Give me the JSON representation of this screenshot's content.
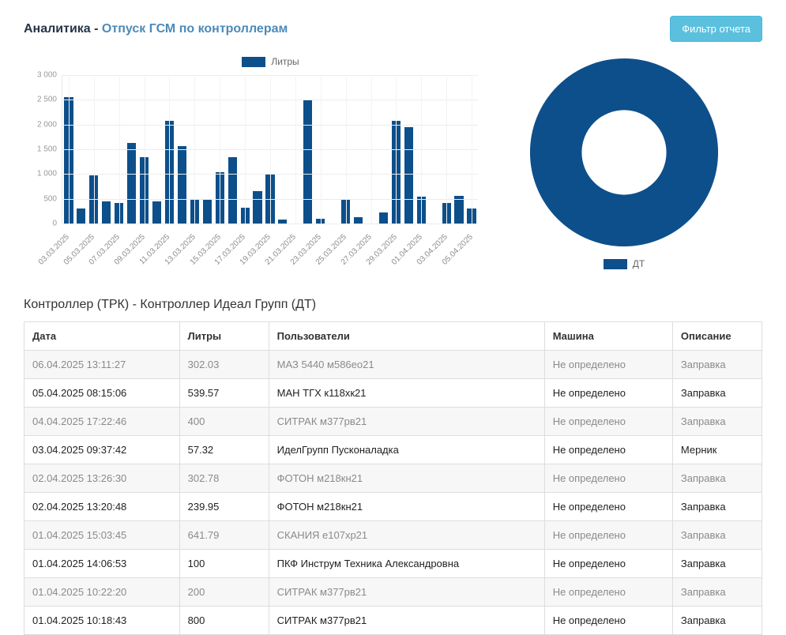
{
  "colors": {
    "primary": "#0d4f8b",
    "accent_blue": "#4d8ab8",
    "button_bg": "#5bc0de"
  },
  "header": {
    "title_prefix": "Аналитика - ",
    "title_main": "Отпуск ГСМ по контроллерам",
    "filter_button": "Фильтр отчета"
  },
  "chart_data": [
    {
      "type": "bar",
      "legend": [
        "Литры"
      ],
      "ylabel": "",
      "xlabel": "",
      "ylim": [
        0,
        3000
      ],
      "ytick_labels": [
        "3 000",
        "2 500",
        "2 000",
        "1 500",
        "1 000",
        "500",
        "0"
      ],
      "tick_labels": [
        "03.03.2025",
        "05.03.2025",
        "07.03.2025",
        "09.03.2025",
        "11.03.2025",
        "13.03.2025",
        "15.03.2025",
        "17.03.2025",
        "19.03.2025",
        "21.03.2025",
        "23.03.2025",
        "25.03.2025",
        "27.03.2025",
        "29.03.2025",
        "01.04.2025",
        "03.04.2025",
        "05.04.2025"
      ],
      "values": [
        2550,
        300,
        980,
        450,
        420,
        1630,
        1340,
        450,
        2080,
        1570,
        480,
        490,
        1040,
        1340,
        320,
        660,
        1000,
        80,
        0,
        2500,
        90,
        0,
        480,
        120,
        0,
        220,
        2070,
        1940,
        550,
        0,
        420,
        560,
        300
      ],
      "grid": true,
      "legend_position": "top"
    },
    {
      "type": "pie",
      "donut": true,
      "legend": [
        "ДТ"
      ],
      "slices": [
        {
          "label": "ДТ",
          "value": 100
        }
      ],
      "legend_position": "bottom"
    }
  ],
  "bar_legend_label": "Литры",
  "donut_legend_label": "ДТ",
  "section": {
    "title": "Контроллер (ТРК) - Контроллер Идеал Групп (ДТ)"
  },
  "table": {
    "columns": [
      "Дата",
      "Литры",
      "Пользователи",
      "Машина",
      "Описание"
    ],
    "rows": [
      [
        "06.04.2025 13:11:27",
        "302.03",
        "МАЗ 5440 м586ео21",
        "Не определено",
        "Заправка"
      ],
      [
        "05.04.2025 08:15:06",
        "539.57",
        "МАН ТГХ к118хк21",
        "Не определено",
        "Заправка"
      ],
      [
        "04.04.2025 17:22:46",
        "400",
        "СИТРАК м377рв21",
        "Не определено",
        "Заправка"
      ],
      [
        "03.04.2025 09:37:42",
        "57.32",
        "ИделГрупп Пусконаладка",
        "Не определено",
        "Мерник"
      ],
      [
        "02.04.2025 13:26:30",
        "302.78",
        "ФОТОН м218кн21",
        "Не определено",
        "Заправка"
      ],
      [
        "02.04.2025 13:20:48",
        "239.95",
        "ФОТОН м218кн21",
        "Не определено",
        "Заправка"
      ],
      [
        "01.04.2025 15:03:45",
        "641.79",
        "СКАНИЯ е107хр21",
        "Не определено",
        "Заправка"
      ],
      [
        "01.04.2025 14:06:53",
        "100",
        "ПКФ Инструм Техника Александровна",
        "Не определено",
        "Заправка"
      ],
      [
        "01.04.2025 10:22:20",
        "200",
        "СИТРАК м377рв21",
        "Не определено",
        "Заправка"
      ],
      [
        "01.04.2025 10:18:43",
        "800",
        "СИТРАК м377рв21",
        "Не определено",
        "Заправка"
      ]
    ]
  }
}
